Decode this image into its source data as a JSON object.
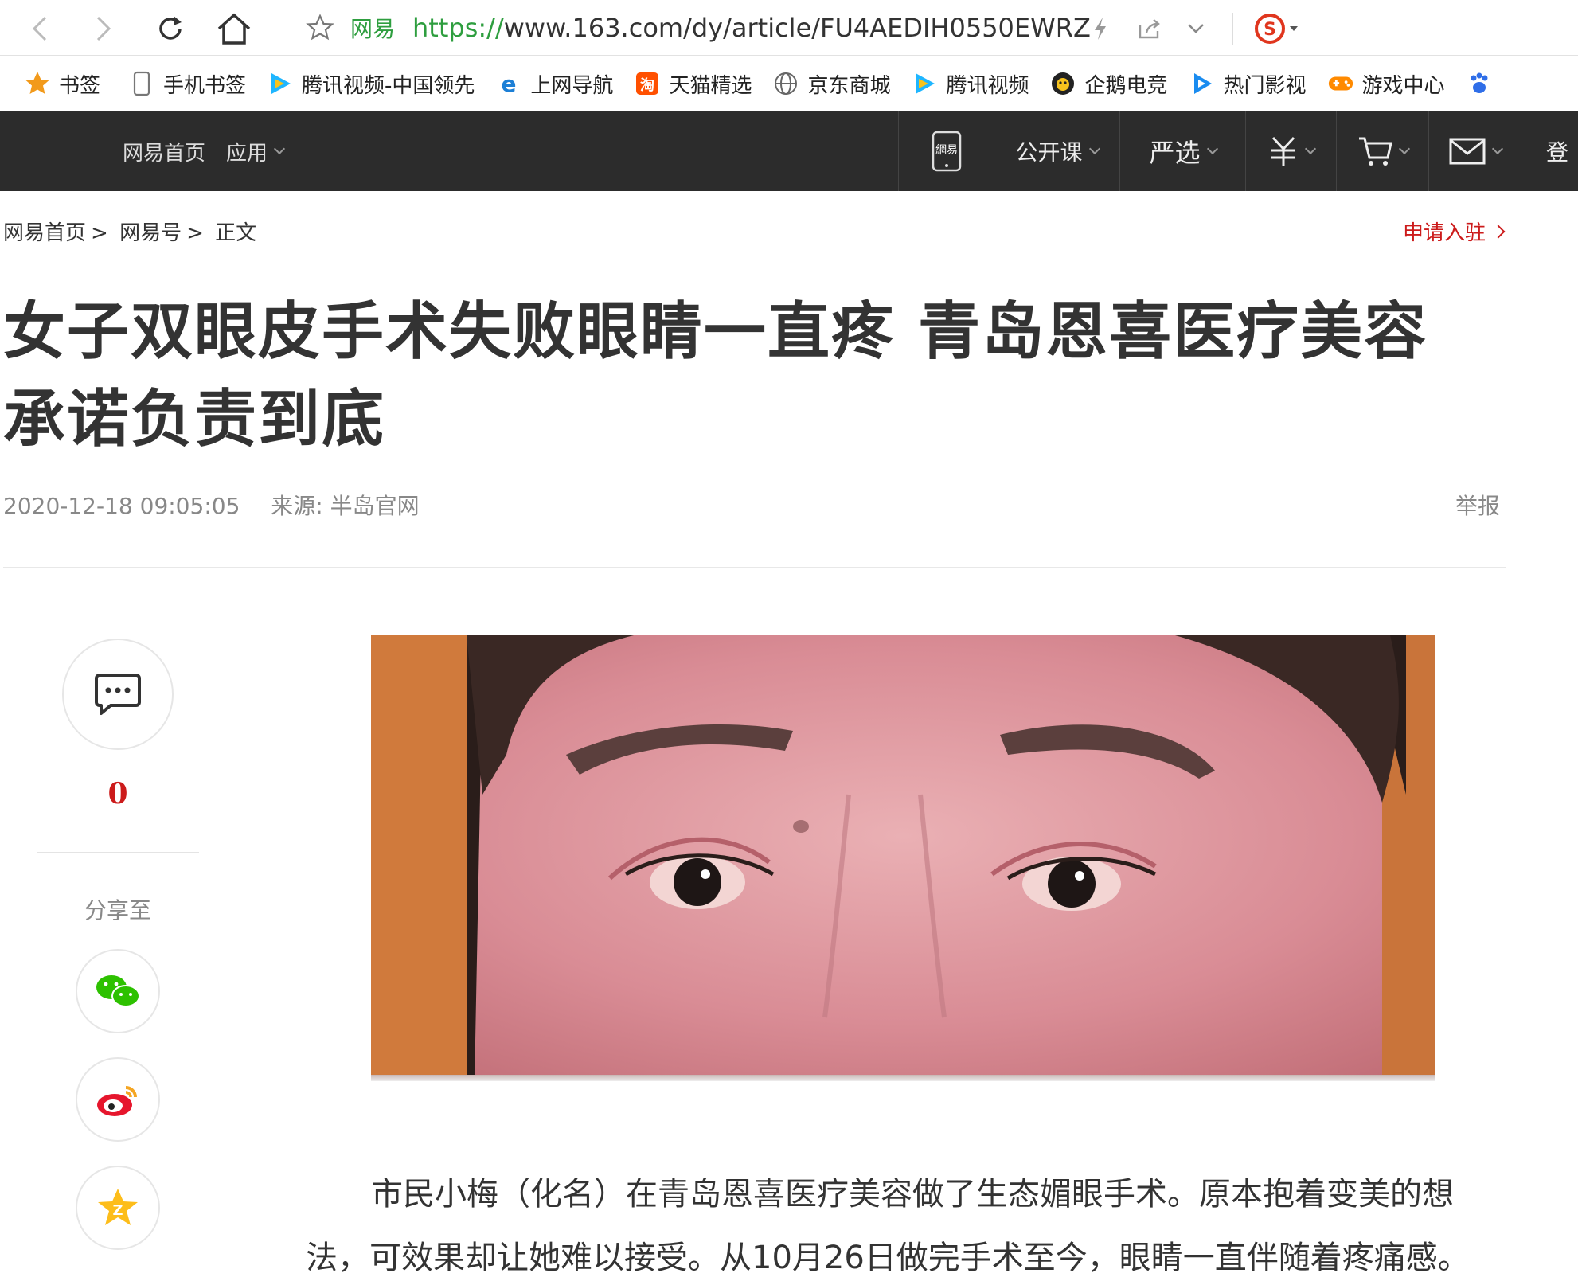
{
  "browser": {
    "site_name": "网易",
    "url_protocol": "https://",
    "url_rest": "www.163.com/dy/article/FU4AEDIH0550EWRZ"
  },
  "bookmarks": [
    {
      "label": "书签",
      "icon": "star-icon"
    },
    {
      "label": "手机书签",
      "icon": "phone-icon"
    },
    {
      "label": "腾讯视频-中国领先",
      "icon": "tencent-video-icon"
    },
    {
      "label": "上网导航",
      "icon": "ie-icon"
    },
    {
      "label": "天猫精选",
      "icon": "tmall-icon"
    },
    {
      "label": "京东商城",
      "icon": "globe-icon"
    },
    {
      "label": "腾讯视频",
      "icon": "tencent-video-icon"
    },
    {
      "label": "企鹅电竞",
      "icon": "penguin-esports-icon"
    },
    {
      "label": "热门影视",
      "icon": "play-icon"
    },
    {
      "label": "游戏中心",
      "icon": "gamepad-icon"
    }
  ],
  "site_nav": {
    "home": "网易首页",
    "apps": "应用",
    "open_course": "公开课",
    "yanxuan": "严选",
    "login_partial": "登",
    "mobile_logo": "網易"
  },
  "breadcrumb": {
    "home": "网易首页",
    "sep": ">",
    "netease_hao": "网易号",
    "current": "正文"
  },
  "apply_link": "申请入驻",
  "article": {
    "title": "女子双眼皮手术失败眼睛一直疼 青岛恩喜医疗美容承诺负责到底",
    "datetime": "2020-12-18 09:05:05",
    "source": "来源: 半岛官网",
    "report": "举报",
    "paragraph": "市民小梅（化名）在青岛恩喜医疗美容做了生态媚眼手术。原本抱着变美的想法，可效果却让她难以接受。从10月26日做完手术至今，眼睛一直伴随着疼痛感。"
  },
  "social": {
    "comment_count": "0",
    "share_label": "分享至"
  },
  "colors": {
    "nav_bg": "#2c2c2c",
    "accent_red": "#cc1b1b",
    "url_green": "#2e9e3f"
  }
}
